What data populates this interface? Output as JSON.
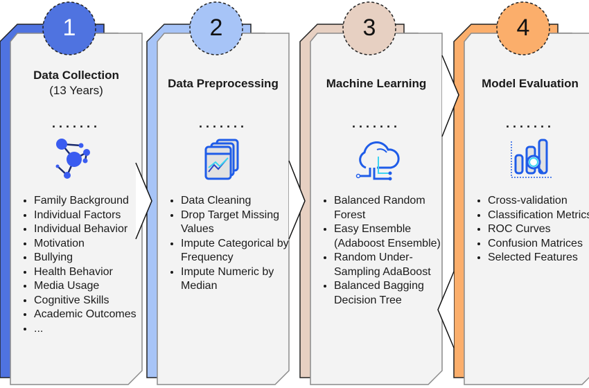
{
  "colors": {
    "step1": "#4f73e0",
    "step2": "#a7c4f7",
    "step3": "#e7d0c2",
    "step4": "#fbae6b",
    "card": "#f3f3f3"
  },
  "steps": [
    {
      "number": "1",
      "title": "Data Collection",
      "subtitle": "(13 Years)",
      "dots": ".......",
      "icon": "network-nodes-icon",
      "items": [
        "Family Background",
        "Individual Factors",
        "Individual Behavior",
        "Motivation",
        "Bullying",
        "Health Behavior",
        "Media Usage",
        "Cognitive Skills",
        "Academic Outcomes",
        "..."
      ]
    },
    {
      "number": "2",
      "title": "Data Preprocessing",
      "dots": ".......",
      "icon": "data-chart-window-icon",
      "items": [
        "Data Cleaning",
        "Drop Target Missing Values",
        "Impute Categorical by Frequency",
        "Impute Numeric by Median"
      ]
    },
    {
      "number": "3",
      "title": "Machine Learning",
      "dots": ".......",
      "icon": "cloud-circuit-icon",
      "items": [
        "Balanced Random Forest",
        "Easy Ensemble (Adaboost Ensemble)",
        "Random Under-Sampling AdaBoost",
        "Balanced Bagging Decision Tree"
      ]
    },
    {
      "number": "4",
      "title": "Model Evaluation",
      "dots": ".......",
      "icon": "bar-chart-magnifier-icon",
      "items": [
        "Cross-validation",
        "Classification Metrics",
        "ROC Curves",
        "Confusion Matrices",
        "Selected Features"
      ]
    }
  ]
}
